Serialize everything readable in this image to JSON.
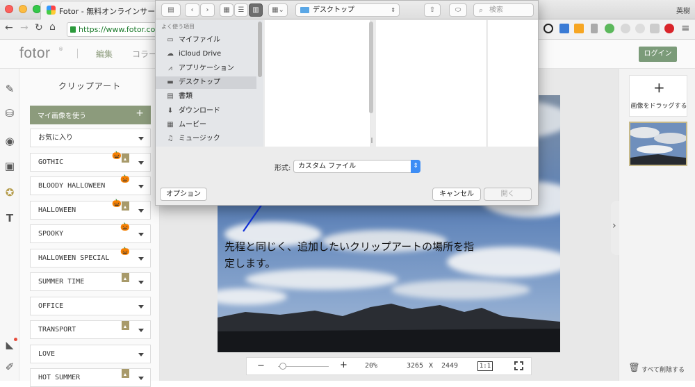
{
  "browser": {
    "tab_title": "Fotor - 無料オンラインサービス",
    "url": "https://www.fotor.com",
    "user_label": "英樹"
  },
  "app": {
    "logo": "fotor",
    "nav": [
      "編集",
      "コラー"
    ],
    "login_label": "ログイン"
  },
  "clipart_panel": {
    "title": "クリップアート",
    "my_images_label": "マイ画像を使う",
    "my_images_plus": "+",
    "categories": [
      {
        "label": "お気に入り",
        "badges": []
      },
      {
        "label": "GOTHIC",
        "badges": [
          "pumpkin",
          "tag"
        ]
      },
      {
        "label": "BLOODY HALLOWEEN",
        "badges": [
          "pumpkin"
        ]
      },
      {
        "label": "HALLOWEEN",
        "badges": [
          "pumpkin",
          "tag"
        ]
      },
      {
        "label": "SPOOKY",
        "badges": [
          "pumpkin"
        ]
      },
      {
        "label": "HALLOWEEN SPECIAL",
        "badges": [
          "pumpkin"
        ]
      },
      {
        "label": "SUMMER TIME",
        "badges": [
          "tag"
        ]
      },
      {
        "label": "OFFICE",
        "badges": []
      },
      {
        "label": "TRANSPORT",
        "badges": [
          "tag"
        ]
      },
      {
        "label": "LOVE",
        "badges": []
      },
      {
        "label": "HOT SUMMER",
        "badges": [
          "tag"
        ]
      }
    ]
  },
  "canvas": {
    "annotation_line1": "先程と同じく、追加したいクリップアートの場所を指",
    "annotation_line2": "定します。",
    "zoom": "20%",
    "width": "3265",
    "x": "X",
    "height": "2449",
    "actual_size": "1:1",
    "zoom_minus": "−",
    "zoom_plus": "+",
    "zoom_slider_value": 0.1
  },
  "right_panel": {
    "add_plus": "+",
    "drag_label": "画像をドラッグする",
    "delete_all_label": "すべて削除する",
    "collapse_arrow": "›"
  },
  "file_dialog": {
    "location": "デスクトップ",
    "search_placeholder": "検索",
    "sidebar_header": "よく使う項目",
    "sidebar_items": [
      "マイファイル",
      "iCloud Drive",
      "アプリケーション",
      "デスクトップ",
      "書類",
      "ダウンロード",
      "ムービー",
      "ミュージック"
    ],
    "selected_item": "デスクトップ",
    "format_label": "形式:",
    "format_value": "カスタム ファイル",
    "options_label": "オプション",
    "cancel_label": "キャンセル",
    "open_label": "開く"
  },
  "colors": {
    "accent_green": "#8c9b7c",
    "login_green": "#7b9b79",
    "arrow_blue": "#1131d6",
    "selection_gray": "#d0d2d6"
  }
}
